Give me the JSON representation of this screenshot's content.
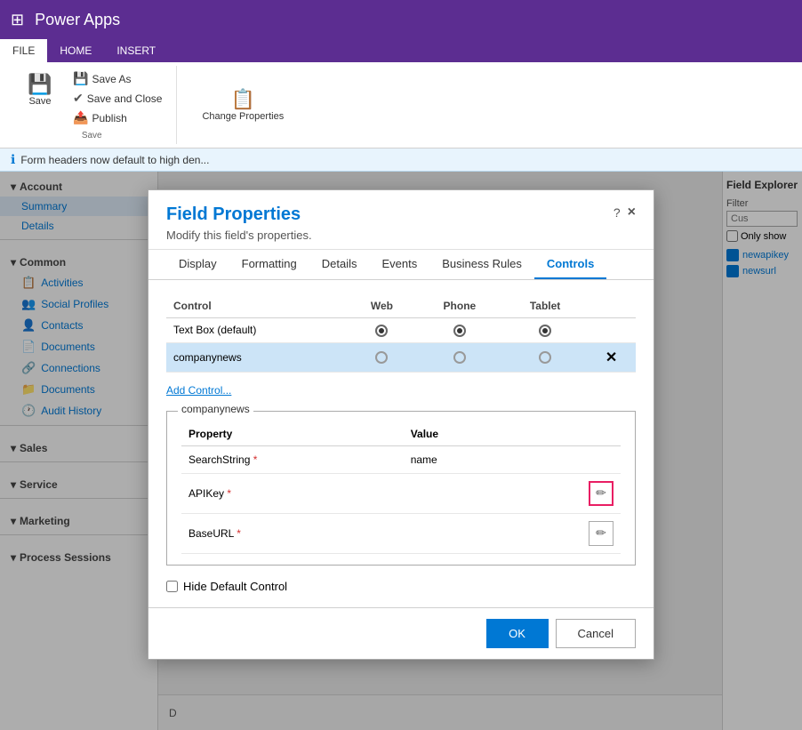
{
  "topbar": {
    "grid_icon": "⊞",
    "app_title": "Power Apps"
  },
  "ribbon": {
    "tabs": [
      {
        "id": "file",
        "label": "FILE"
      },
      {
        "id": "home",
        "label": "HOME"
      },
      {
        "id": "insert",
        "label": "INSERT"
      }
    ],
    "active_tab": "home",
    "save_btn_label": "Save",
    "save_as_label": "Save As",
    "save_close_label": "Save and Close",
    "publish_label": "Publish",
    "change_props_label": "Change Properties",
    "group_save_label": "Save"
  },
  "info_bar": {
    "message": "Form headers now default to high den..."
  },
  "sidebar": {
    "sections": [
      {
        "id": "account",
        "label": "Account",
        "items": [
          {
            "id": "summary",
            "label": "Summary"
          },
          {
            "id": "details",
            "label": "Details"
          }
        ]
      },
      {
        "id": "common",
        "label": "Common",
        "items": [
          {
            "id": "activities",
            "label": "Activities"
          },
          {
            "id": "social-profiles",
            "label": "Social Profiles"
          },
          {
            "id": "contacts",
            "label": "Contacts"
          },
          {
            "id": "documents",
            "label": "Documents"
          },
          {
            "id": "connections",
            "label": "Connections"
          },
          {
            "id": "documents2",
            "label": "Documents"
          },
          {
            "id": "audit-history",
            "label": "Audit History"
          }
        ]
      },
      {
        "id": "sales",
        "label": "Sales",
        "items": []
      },
      {
        "id": "service",
        "label": "Service",
        "items": []
      },
      {
        "id": "marketing",
        "label": "Marketing",
        "items": []
      },
      {
        "id": "process-sessions",
        "label": "Process Sessions",
        "items": []
      }
    ]
  },
  "right_panel": {
    "title": "Field Explorer",
    "filter_label": "Filter",
    "filter_placeholder": "Cus",
    "only_show_label": "Only show",
    "items": [
      {
        "id": "newapikey",
        "label": "newapikey"
      },
      {
        "id": "newsurl",
        "label": "newsurl"
      }
    ]
  },
  "dialog": {
    "title": "Field Properties",
    "subtitle": "Modify this field's properties.",
    "help_btn": "?",
    "close_btn": "×",
    "tabs": [
      {
        "id": "display",
        "label": "Display"
      },
      {
        "id": "formatting",
        "label": "Formatting"
      },
      {
        "id": "details",
        "label": "Details"
      },
      {
        "id": "events",
        "label": "Events"
      },
      {
        "id": "business-rules",
        "label": "Business Rules"
      },
      {
        "id": "controls",
        "label": "Controls"
      }
    ],
    "active_tab": "controls",
    "controls_table": {
      "headers": [
        {
          "id": "control",
          "label": "Control"
        },
        {
          "id": "web",
          "label": "Web"
        },
        {
          "id": "phone",
          "label": "Phone"
        },
        {
          "id": "tablet",
          "label": "Tablet"
        }
      ],
      "rows": [
        {
          "id": "textbox",
          "control": "Text Box (default)",
          "web_selected": true,
          "phone_selected": true,
          "tablet_selected": true,
          "selected": false,
          "has_delete": false
        },
        {
          "id": "companynews",
          "control": "companynews",
          "web_selected": false,
          "phone_selected": false,
          "tablet_selected": false,
          "selected": true,
          "has_delete": true
        }
      ]
    },
    "add_control_link": "Add Control...",
    "companynews_section_label": "companynews",
    "properties_table": {
      "headers": [
        {
          "id": "property",
          "label": "Property"
        },
        {
          "id": "value",
          "label": "Value"
        }
      ],
      "rows": [
        {
          "id": "searchstring",
          "property": "SearchString",
          "required": true,
          "value": "name",
          "has_edit": false,
          "edit_highlighted": false
        },
        {
          "id": "apikey",
          "property": "APIKey",
          "required": true,
          "value": "",
          "has_edit": true,
          "edit_highlighted": true
        },
        {
          "id": "baseurl",
          "property": "BaseURL",
          "required": true,
          "value": "",
          "has_edit": true,
          "edit_highlighted": false
        }
      ]
    },
    "hide_default_label": "Hide Default Control",
    "ok_label": "OK",
    "cancel_label": "Cancel"
  },
  "center_bottom": {
    "label": "D"
  },
  "colors": {
    "accent": "#0078d4",
    "brand": "#5c2d91",
    "highlight_pink": "#e91e63"
  }
}
